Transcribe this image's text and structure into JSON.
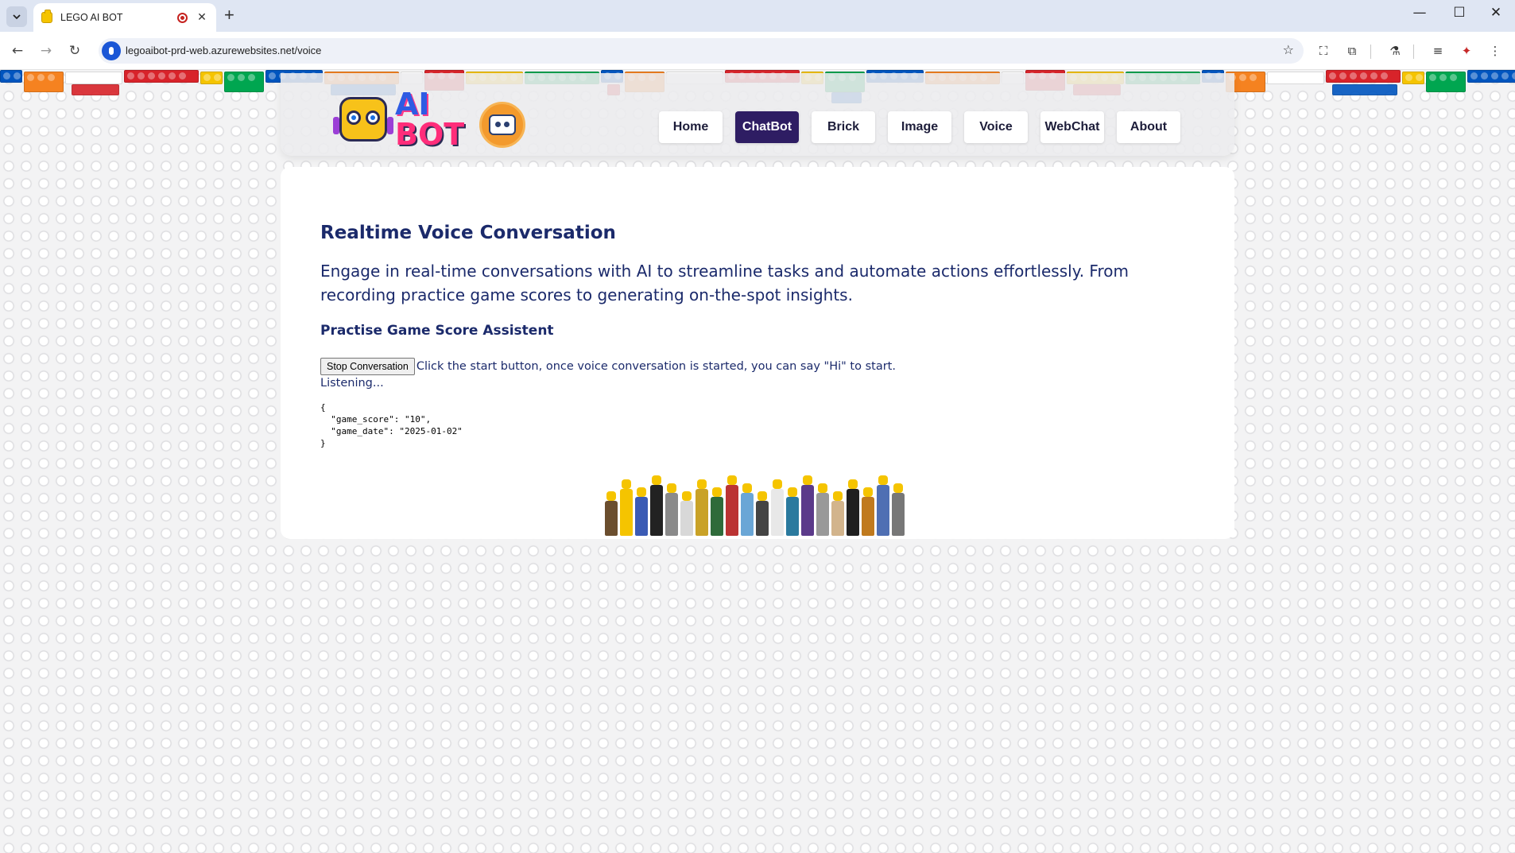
{
  "browser": {
    "tab_title": "LEGO AI BOT",
    "tab_close": "✕",
    "new_tab": "+",
    "url": "legoaibot-prd-web.azurewebsites.net/voice",
    "window_controls": {
      "minimize": "—",
      "maximize": "☐",
      "close": "✕"
    }
  },
  "header": {
    "logo_line1": "AI",
    "logo_line2": "BOT",
    "nav": [
      {
        "label": "Home"
      },
      {
        "label": "ChatBot",
        "active": true
      },
      {
        "label": "Brick"
      },
      {
        "label": "Image"
      },
      {
        "label": "Voice"
      },
      {
        "label": "WebChat"
      },
      {
        "label": "About"
      }
    ]
  },
  "main": {
    "title": "Realtime Voice Conversation",
    "lead": "Engage in real-time conversations with AI to streamline tasks and automate actions effortlessly. From recording practice game scores to generating on-the-spot insights.",
    "subheading": "Practise Game Score Assistent",
    "stop_button": "Stop Conversation",
    "hint": "Click the start button, once voice conversation is started, you can say \"Hi\" to start.",
    "status": "Listening...",
    "json_output": "{\n  \"game_score\": \"10\",\n  \"game_date\": \"2025-01-02\"\n}"
  },
  "colors": {
    "accent": "#2e1d63",
    "text": "#1b2a6b",
    "lego": [
      "#d8232a",
      "#f5c400",
      "#00a650",
      "#0055bf",
      "#f58220",
      "#ffffff"
    ]
  }
}
